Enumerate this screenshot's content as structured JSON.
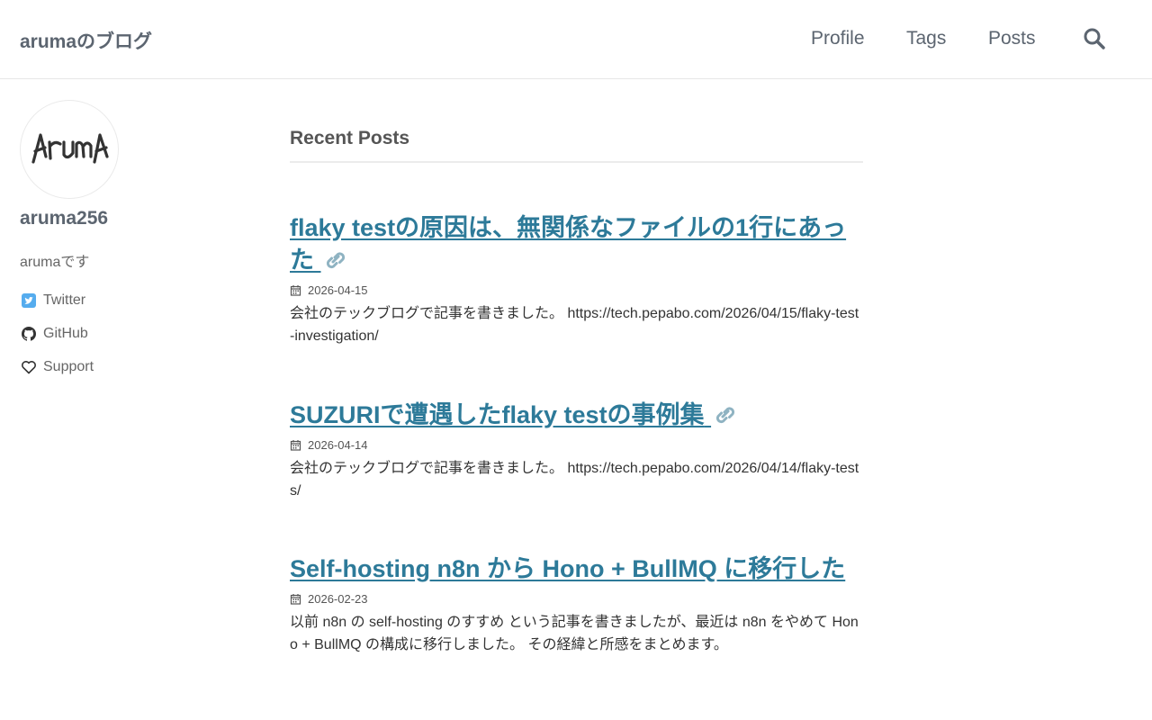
{
  "header": {
    "site_title": "arumaのブログ",
    "nav": [
      {
        "label": "Profile"
      },
      {
        "label": "Tags"
      },
      {
        "label": "Posts"
      }
    ],
    "search_icon": "search-icon"
  },
  "sidebar": {
    "avatar_text": "ArumA",
    "author_name": "aruma256",
    "bio": "arumaです",
    "links": [
      {
        "label": "Twitter",
        "icon": "twitter-icon",
        "color": "#55acee"
      },
      {
        "label": "GitHub",
        "icon": "github-icon"
      },
      {
        "label": "Support",
        "icon": "heart-icon"
      }
    ]
  },
  "main": {
    "section_title": "Recent Posts",
    "posts": [
      {
        "title": "flaky testの原因は、無関係なファイルの1行にあった",
        "date": "2026-04-15",
        "summary": "会社のテックブログで記事を書きました。 https://tech.pepabo.com/2026/04/15/flaky-test-investigation/",
        "external": true
      },
      {
        "title": "SUZURIで遭遇したflaky testの事例集",
        "date": "2026-04-14",
        "summary": "会社のテックブログで記事を書きました。 https://tech.pepabo.com/2026/04/14/flaky-tests/",
        "external": true
      },
      {
        "title": "Self-hosting n8n から Hono + BullMQ に移行した",
        "date": "2026-02-23",
        "summary": "以前 n8n の self-hosting のすすめ という記事を書きましたが、最近は n8n をやめて Hono + BullMQ の構成に移行しました。 その経緯と所感をまとめます。",
        "external": false
      }
    ]
  },
  "colors": {
    "link": "#2d7a99",
    "header_text": "#5c6570"
  }
}
